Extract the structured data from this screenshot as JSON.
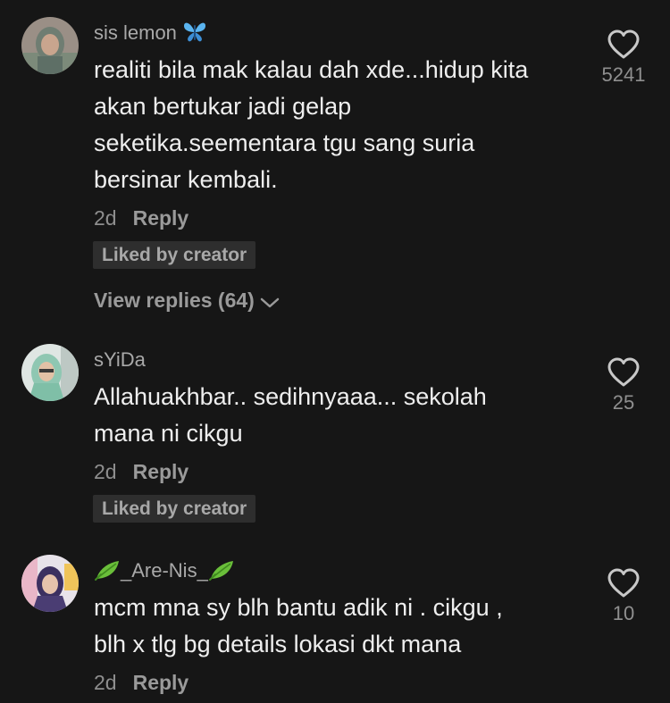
{
  "comments": [
    {
      "username": "sis lemon",
      "username_emoji": "butterfly-emoji",
      "lines": [
        "realiti bila mak kalau dah xde...hidup kita",
        "akan bertukar jadi gelap",
        "seketika.seementara tgu sang suria",
        "bersinar kembali."
      ],
      "time": "2d",
      "reply_label": "Reply",
      "liked_label": "Liked by creator",
      "view_replies_label": "View replies (64)",
      "likes": "5241"
    },
    {
      "username": "sYiDa",
      "lines": [
        "Allahuakhbar.. sedihnyaaa... sekolah",
        "mana ni cikgu"
      ],
      "time": "2d",
      "reply_label": "Reply",
      "liked_label": "Liked by creator",
      "likes": "25"
    },
    {
      "username": "_Are-Nis_",
      "username_emoji": "herb-emoji",
      "lines": [
        "mcm mna sy blh bantu adik ni . cikgu ,",
        "blh x tlg bg details lokasi dkt mana"
      ],
      "time": "2d",
      "reply_label": "Reply",
      "likes": "10"
    }
  ],
  "colors": {
    "background": "#161616",
    "text": "#eeeeee",
    "muted": "#8e8e8e",
    "badge_bg": "#2e2e2e",
    "butterfly": "#5ab4f0",
    "herb": "#6abf3a"
  }
}
